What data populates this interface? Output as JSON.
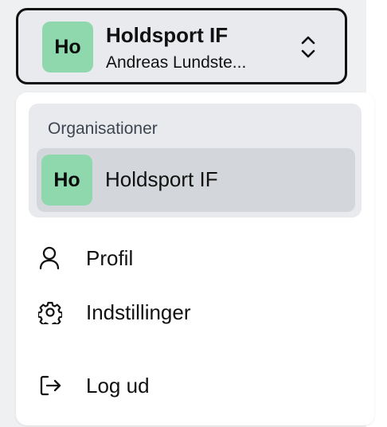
{
  "switcher": {
    "avatar_initials": "Ho",
    "org_name": "Holdsport IF",
    "user_name": "Andreas Lundste...",
    "chevron_icon": "chevron-up-down-icon"
  },
  "menu": {
    "organizations": {
      "title": "Organisationer",
      "items": [
        {
          "initials": "Ho",
          "label": "Holdsport IF",
          "selected": true
        }
      ]
    },
    "items": [
      {
        "label": "Profil",
        "icon": "user-icon"
      },
      {
        "label": "Indstillinger",
        "icon": "gear-icon"
      },
      {
        "label": "Log ud",
        "icon": "logout-icon"
      }
    ]
  },
  "colors": {
    "avatar_bg": "#8fd8ad",
    "section_bg": "#e8eaee",
    "selected_bg": "#d3d6db",
    "border": "#111111"
  }
}
